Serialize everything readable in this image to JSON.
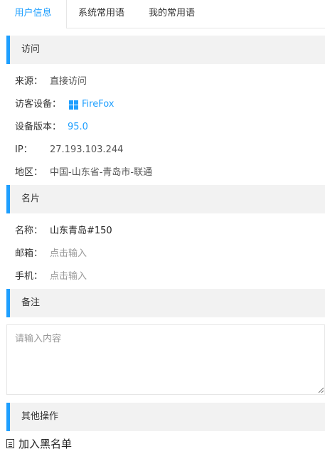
{
  "tabs": {
    "active": "用户信息",
    "system_phrases": "系统常用语",
    "my_phrases": "我的常用语"
  },
  "visit": {
    "header": "访问",
    "source_label": "来源：",
    "source_value": "直接访问",
    "device_label": "访客设备：",
    "device_icon": "windows-icon",
    "device_value": "FireFox",
    "version_label": "设备版本：",
    "version_value": "95.0",
    "ip_label": "IP：",
    "ip_value": "27.193.103.244",
    "region_label": "地区：",
    "region_value": "中国-山东省-青岛市-联通"
  },
  "card": {
    "header": "名片",
    "name_label": "名称：",
    "name_value": "山东青岛#150",
    "email_label": "邮箱：",
    "email_placeholder": "点击输入",
    "phone_label": "手机：",
    "phone_placeholder": "点击输入"
  },
  "remark": {
    "header": "备注",
    "placeholder": "请输入内容"
  },
  "other": {
    "header": "其他操作",
    "blacklist_icon": "document-icon",
    "blacklist_label": "加入黑名单"
  },
  "colors": {
    "accent": "#1E9FFF",
    "section_bg": "#f2f2f2"
  }
}
